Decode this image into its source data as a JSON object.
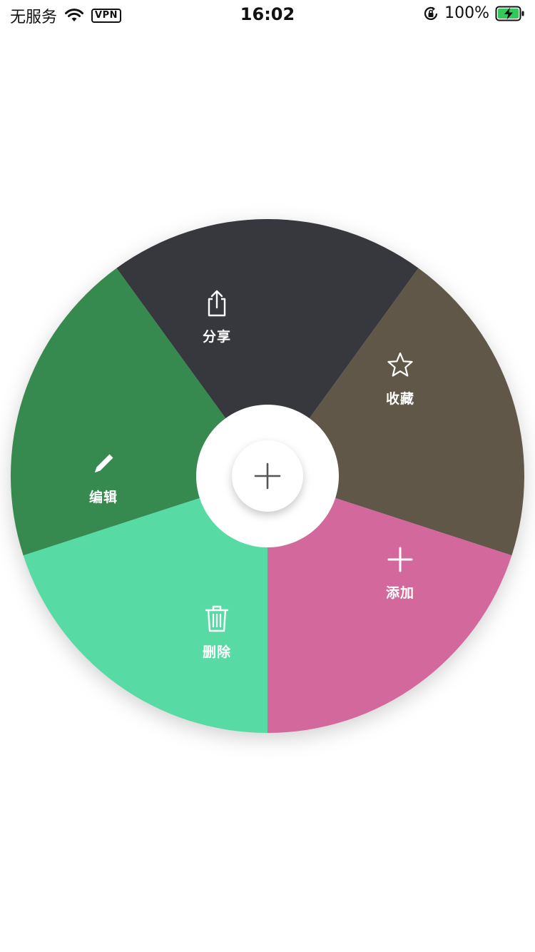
{
  "status_bar": {
    "carrier": "无服务",
    "vpn": "VPN",
    "time": "16:02",
    "battery": "100%",
    "icons": [
      "wifi-icon",
      "vpn-icon",
      "orientation-lock-icon",
      "battery-charging-icon"
    ]
  },
  "radial_menu": {
    "center_icon": "plus-icon",
    "items": [
      {
        "label": "分享",
        "icon": "share-icon",
        "color": "#37383E"
      },
      {
        "label": "收藏",
        "icon": "star-icon",
        "color": "#615749"
      },
      {
        "label": "添加",
        "icon": "plus-icon",
        "color": "#D3689C"
      },
      {
        "label": "删除",
        "icon": "trash-icon",
        "color": "#58DAA4"
      },
      {
        "label": "编辑",
        "icon": "pencil-icon",
        "color": "#378A4F"
      }
    ]
  }
}
